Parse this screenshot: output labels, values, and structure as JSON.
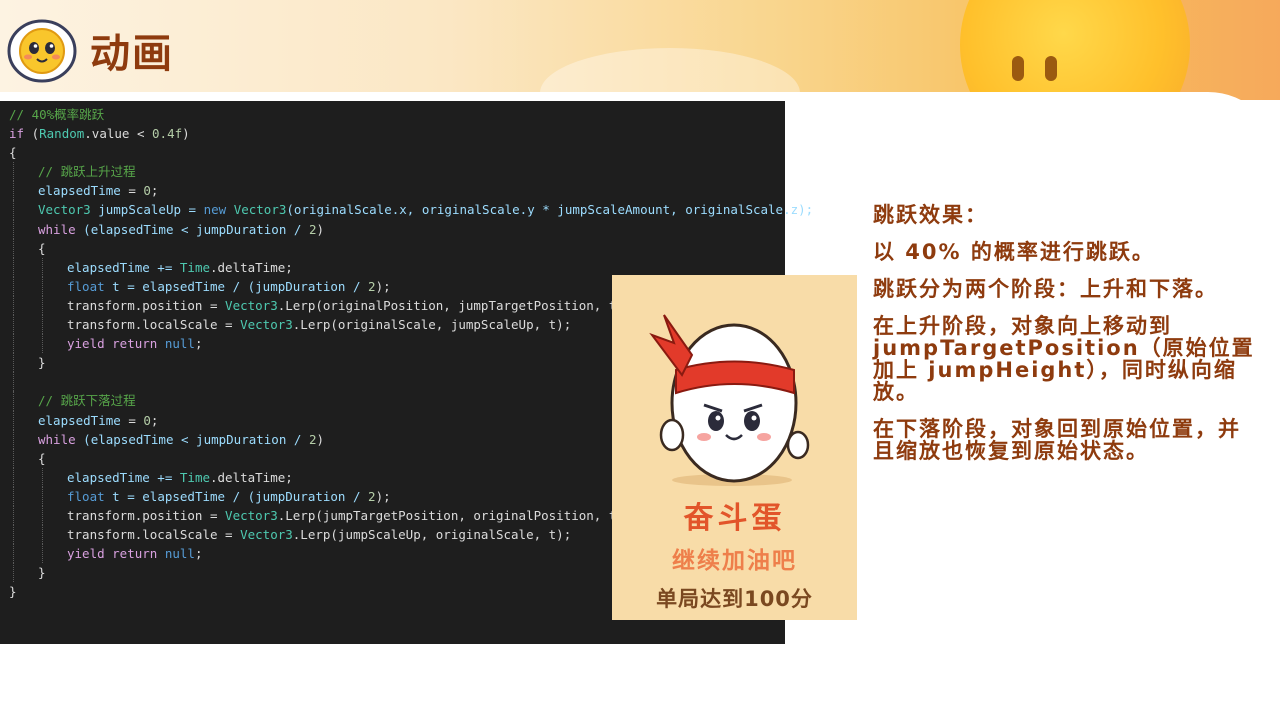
{
  "header": {
    "title": "动画"
  },
  "code": {
    "lines": [
      {
        "indent": 0,
        "tokens": [
          {
            "t": "// 40%概率跳跃",
            "c": "com"
          }
        ]
      },
      {
        "indent": 0,
        "tokens": [
          {
            "t": "if",
            "c": "ctl"
          },
          {
            "t": " (",
            "c": "txt"
          },
          {
            "t": "Random",
            "c": "type"
          },
          {
            "t": ".value < ",
            "c": "txt"
          },
          {
            "t": "0.4f",
            "c": "num"
          },
          {
            "t": ")",
            "c": "txt"
          }
        ]
      },
      {
        "indent": 0,
        "tokens": [
          {
            "t": "{",
            "c": "txt"
          }
        ]
      },
      {
        "indent": 1,
        "tokens": [
          {
            "t": "// 跳跃上升过程",
            "c": "com"
          }
        ]
      },
      {
        "indent": 1,
        "tokens": [
          {
            "t": "elapsedTime",
            "c": "var"
          },
          {
            "t": " = ",
            "c": "txt"
          },
          {
            "t": "0",
            "c": "num"
          },
          {
            "t": ";",
            "c": "txt"
          }
        ]
      },
      {
        "indent": 1,
        "tokens": [
          {
            "t": "Vector3",
            "c": "type"
          },
          {
            "t": " jumpScaleUp = ",
            "c": "var"
          },
          {
            "t": "new ",
            "c": "kw"
          },
          {
            "t": "Vector3",
            "c": "type"
          },
          {
            "t": "(originalScale.x, originalScale.y * jumpScaleAmount, originalScale.z);",
            "c": "var"
          }
        ]
      },
      {
        "indent": 1,
        "tokens": [
          {
            "t": "while",
            "c": "ctl"
          },
          {
            "t": " (elapsedTime < jumpDuration / ",
            "c": "var"
          },
          {
            "t": "2",
            "c": "num"
          },
          {
            "t": ")",
            "c": "txt"
          }
        ]
      },
      {
        "indent": 1,
        "tokens": [
          {
            "t": "{",
            "c": "txt"
          }
        ]
      },
      {
        "indent": 2,
        "tokens": [
          {
            "t": "elapsedTime += ",
            "c": "var"
          },
          {
            "t": "Time",
            "c": "type"
          },
          {
            "t": ".deltaTime;",
            "c": "txt"
          }
        ]
      },
      {
        "indent": 2,
        "tokens": [
          {
            "t": "float",
            "c": "kw"
          },
          {
            "t": " t = elapsedTime / (jumpDuration / ",
            "c": "var"
          },
          {
            "t": "2",
            "c": "num"
          },
          {
            "t": ");",
            "c": "txt"
          }
        ]
      },
      {
        "indent": 2,
        "tokens": [
          {
            "t": "transform.position = ",
            "c": "txt"
          },
          {
            "t": "Vector3",
            "c": "type"
          },
          {
            "t": ".Lerp(originalPosition, jumpTargetPosition, t);",
            "c": "txt"
          }
        ]
      },
      {
        "indent": 2,
        "tokens": [
          {
            "t": "transform.localScale = ",
            "c": "txt"
          },
          {
            "t": "Vector3",
            "c": "type"
          },
          {
            "t": ".Lerp(originalScale, jumpScaleUp, t);",
            "c": "txt"
          }
        ]
      },
      {
        "indent": 2,
        "tokens": [
          {
            "t": "yield return ",
            "c": "ctl"
          },
          {
            "t": "null",
            "c": "kw"
          },
          {
            "t": ";",
            "c": "txt"
          }
        ]
      },
      {
        "indent": 1,
        "tokens": [
          {
            "t": "}",
            "c": "txt"
          }
        ]
      },
      {
        "indent": 1,
        "tokens": []
      },
      {
        "indent": 1,
        "tokens": [
          {
            "t": "// 跳跃下落过程",
            "c": "com"
          }
        ]
      },
      {
        "indent": 1,
        "tokens": [
          {
            "t": "elapsedTime",
            "c": "var"
          },
          {
            "t": " = ",
            "c": "txt"
          },
          {
            "t": "0",
            "c": "num"
          },
          {
            "t": ";",
            "c": "txt"
          }
        ]
      },
      {
        "indent": 1,
        "tokens": [
          {
            "t": "while",
            "c": "ctl"
          },
          {
            "t": " (elapsedTime < jumpDuration / ",
            "c": "var"
          },
          {
            "t": "2",
            "c": "num"
          },
          {
            "t": ")",
            "c": "txt"
          }
        ]
      },
      {
        "indent": 1,
        "tokens": [
          {
            "t": "{",
            "c": "txt"
          }
        ]
      },
      {
        "indent": 2,
        "tokens": [
          {
            "t": "elapsedTime += ",
            "c": "var"
          },
          {
            "t": "Time",
            "c": "type"
          },
          {
            "t": ".deltaTime;",
            "c": "txt"
          }
        ]
      },
      {
        "indent": 2,
        "tokens": [
          {
            "t": "float",
            "c": "kw"
          },
          {
            "t": " t = elapsedTime / (jumpDuration / ",
            "c": "var"
          },
          {
            "t": "2",
            "c": "num"
          },
          {
            "t": ");",
            "c": "txt"
          }
        ]
      },
      {
        "indent": 2,
        "tokens": [
          {
            "t": "transform.position = ",
            "c": "txt"
          },
          {
            "t": "Vector3",
            "c": "type"
          },
          {
            "t": ".Lerp(jumpTargetPosition, originalPosition, t);",
            "c": "txt"
          }
        ]
      },
      {
        "indent": 2,
        "tokens": [
          {
            "t": "transform.localScale = ",
            "c": "txt"
          },
          {
            "t": "Vector3",
            "c": "type"
          },
          {
            "t": ".Lerp(jumpScaleUp, originalScale, t);",
            "c": "txt"
          }
        ]
      },
      {
        "indent": 2,
        "tokens": [
          {
            "t": "yield return ",
            "c": "ctl"
          },
          {
            "t": "null",
            "c": "kw"
          },
          {
            "t": ";",
            "c": "txt"
          }
        ]
      },
      {
        "indent": 1,
        "tokens": [
          {
            "t": "}",
            "c": "txt"
          }
        ]
      },
      {
        "indent": 0,
        "tokens": [
          {
            "t": "}",
            "c": "txt"
          }
        ]
      }
    ]
  },
  "egg_image": {
    "caption_main": "奋斗蛋",
    "caption_sub": "继续加油吧",
    "caption_goal": "单局达到100分"
  },
  "description": {
    "paragraphs": [
      "跳跃效果：",
      "以 40% 的概率进行跳跃。",
      "跳跃分为两个阶段：上升和下落。",
      "在上升阶段，对象向上移动到jumpTargetPosition（原始位置加上 jumpHeight），同时纵向缩放。",
      "在下落阶段，对象回到原始位置，并且缩放也恢复到原始状态。"
    ]
  },
  "colors": {
    "title": "#8e3b0e",
    "code_bg": "#1e1e1e",
    "egg_card_bg": "#f8dca8",
    "banner_glow": "#ffc02b"
  }
}
